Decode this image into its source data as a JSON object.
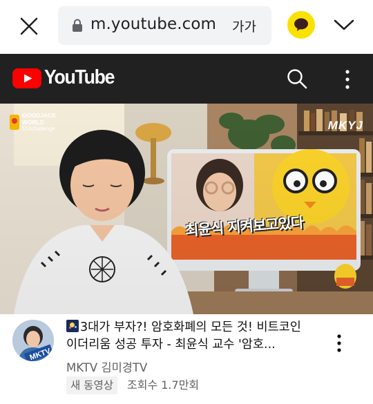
{
  "browser": {
    "url": "m.youtube.com",
    "font_size_label": "가가"
  },
  "youtube": {
    "wordmark": "YouTube",
    "brand_red": "#ff0000"
  },
  "thumbnail": {
    "corner_logo_line1": "GOODJACK",
    "corner_logo_line2": "WORLD",
    "corner_logo_line3": "514challenge",
    "watermark": "MKYJ",
    "monitor_caption": "최윤식 지켜보고있다"
  },
  "video": {
    "title": "3대가 부자?! 암호화폐의 모든 것! 비트코인 이더리움 성공 투자 - 최윤식 교수 '암호...",
    "channel": "MKTV 김미경TV",
    "badge": "새 동영상",
    "views": "조회수 1.7만회",
    "avatar_text": "MKTV"
  }
}
